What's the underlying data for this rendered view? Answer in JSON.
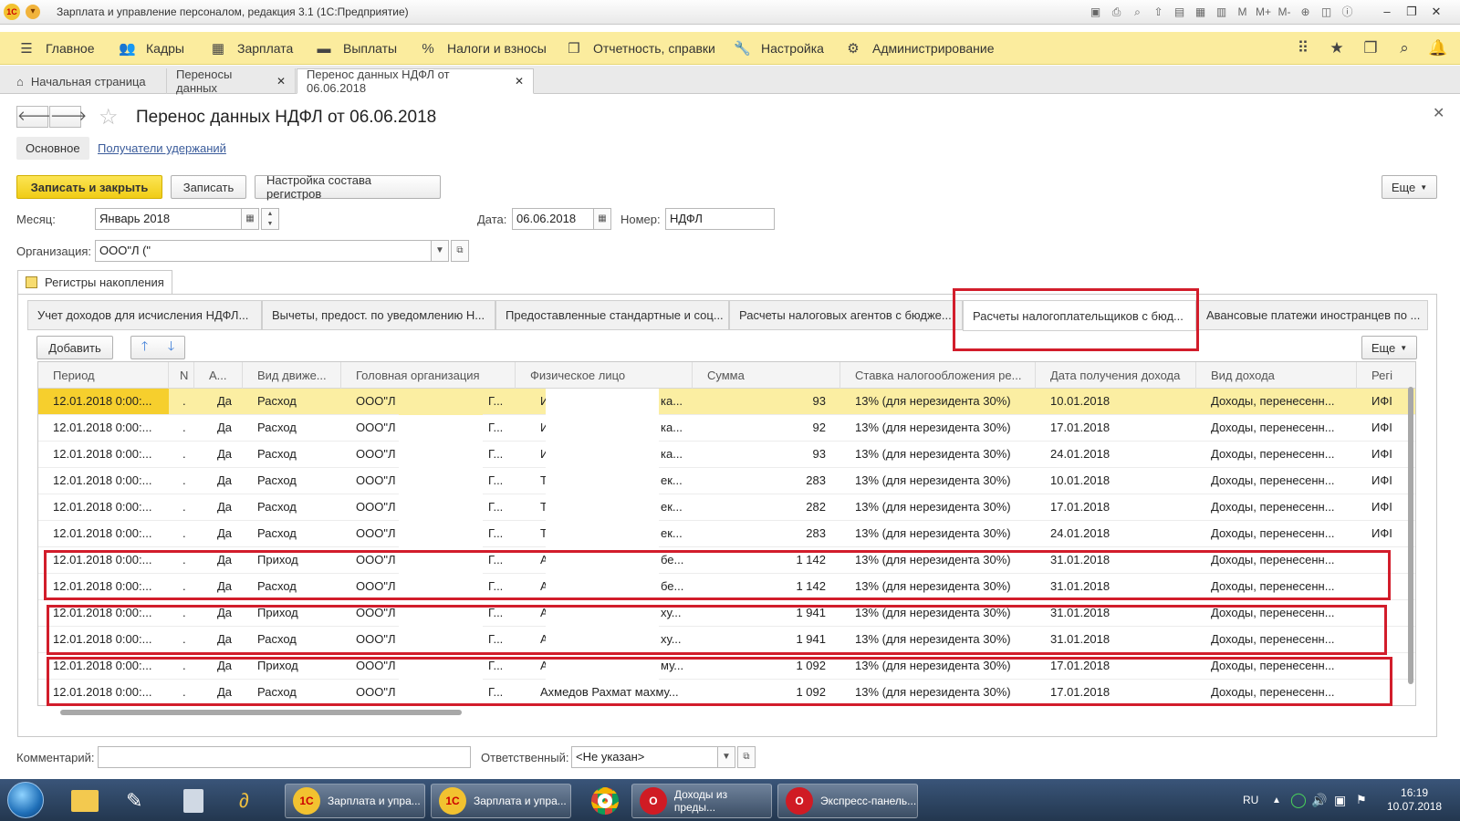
{
  "window": {
    "title": "Зарплата и управление персоналом, редакция 3.1  (1С:Предприятие)"
  },
  "main_menu": [
    "Главное",
    "Кадры",
    "Зарплата",
    "Выплаты",
    "Налоги и взносы",
    "Отчетность, справки",
    "Настройка",
    "Администрирование"
  ],
  "window_tabs": [
    "Начальная страница",
    "Переносы данных",
    "Перенос данных НДФЛ от 06.06.2018"
  ],
  "form": {
    "title": "Перенос данных НДФЛ от 06.06.2018",
    "subnav": [
      "Основное",
      "Получатели удержаний"
    ],
    "buttons": {
      "save_close": "Записать и закрыть",
      "save": "Записать",
      "registers": "Настройка состава регистров",
      "more": "Еще"
    },
    "month_label": "Месяц:",
    "month_value": "Январь 2018",
    "date_label": "Дата:",
    "date_value": "06.06.2018",
    "number_label": "Номер:",
    "number_value": "НДФЛ",
    "org_label": "Организация:",
    "org_value": "ООО\"Л                 (\"",
    "group_tab": "Регистры накопления",
    "register_tabs": [
      "Учет доходов для исчисления НДФЛ...",
      "Вычеты, предост. по уведомлению Н...",
      "Предоставленные стандартные и соц...",
      "Расчеты налоговых агентов с бюдже...",
      "Расчеты налогоплательщиков с бюд...",
      "Авансовые платежи иностранцев по ..."
    ],
    "grid_buttons": {
      "add": "Добавить",
      "more": "Еще"
    },
    "comment_label": "Комментарий:",
    "responsible_label": "Ответственный:",
    "responsible_value": "<Не указан>"
  },
  "grid": {
    "columns": [
      "Период",
      "N",
      "А...",
      "Вид движе...",
      "Головная организация",
      "Физическое лицо",
      "Сумма",
      "Ставка налогообложения ре...",
      "Дата получения дохода",
      "Вид дохода",
      "Регі"
    ],
    "rows": [
      [
        "12.01.2018 0:00:...",
        ".",
        "Да",
        "Расход",
        "ООО\"Л",
        "Г...",
        "И",
        "ка...",
        "93",
        "13% (для нерезидента 30%)",
        "10.01.2018",
        "Доходы, перенесенн...",
        "ИФІ"
      ],
      [
        "12.01.2018 0:00:...",
        ".",
        "Да",
        "Расход",
        "ООО\"Л",
        "Г...",
        "И",
        "ка...",
        "92",
        "13% (для нерезидента 30%)",
        "17.01.2018",
        "Доходы, перенесенн...",
        "ИФІ"
      ],
      [
        "12.01.2018 0:00:...",
        ".",
        "Да",
        "Расход",
        "ООО\"Л",
        "Г...",
        "И",
        "ка...",
        "93",
        "13% (для нерезидента 30%)",
        "24.01.2018",
        "Доходы, перенесенн...",
        "ИФІ"
      ],
      [
        "12.01.2018 0:00:...",
        ".",
        "Да",
        "Расход",
        "ООО\"Л",
        "Г...",
        "Т",
        "ек...",
        "283",
        "13% (для нерезидента 30%)",
        "10.01.2018",
        "Доходы, перенесенн...",
        "ИФІ"
      ],
      [
        "12.01.2018 0:00:...",
        ".",
        "Да",
        "Расход",
        "ООО\"Л",
        "Г...",
        "Т",
        "ек...",
        "282",
        "13% (для нерезидента 30%)",
        "17.01.2018",
        "Доходы, перенесенн...",
        "ИФІ"
      ],
      [
        "12.01.2018 0:00:...",
        ".",
        "Да",
        "Расход",
        "ООО\"Л",
        "Г...",
        "Т",
        "ек...",
        "283",
        "13% (для нерезидента 30%)",
        "24.01.2018",
        "Доходы, перенесенн...",
        "ИФІ"
      ],
      [
        "12.01.2018 0:00:...",
        ".",
        "Да",
        "Приход",
        "ООО\"Л",
        "Г...",
        "А",
        "бе...",
        "1 142",
        "13% (для нерезидента 30%)",
        "31.01.2018",
        "Доходы, перенесенн...",
        ""
      ],
      [
        "12.01.2018 0:00:...",
        ".",
        "Да",
        "Расход",
        "ООО\"Л",
        "Г...",
        "А",
        "бе...",
        "1 142",
        "13% (для нерезидента 30%)",
        "31.01.2018",
        "Доходы, перенесенн...",
        ""
      ],
      [
        "12.01.2018 0:00:...",
        ".",
        "Да",
        "Приход",
        "ООО\"Л",
        "Г...",
        "А",
        "ху...",
        "1 941",
        "13% (для нерезидента 30%)",
        "31.01.2018",
        "Доходы, перенесенн...",
        ""
      ],
      [
        "12.01.2018 0:00:...",
        ".",
        "Да",
        "Расход",
        "ООО\"Л",
        "Г...",
        "А",
        "ху...",
        "1 941",
        "13% (для нерезидента 30%)",
        "31.01.2018",
        "Доходы, перенесенн...",
        ""
      ],
      [
        "12.01.2018 0:00:...",
        ".",
        "Да",
        "Приход",
        "ООО\"Л",
        "Г...",
        "А",
        "му...",
        "1 092",
        "13% (для нерезидента 30%)",
        "17.01.2018",
        "Доходы, перенесенн...",
        ""
      ],
      [
        "12.01.2018 0:00:...",
        ".",
        "Да",
        "Расход",
        "ООО\"Л",
        "Г...",
        "Ахмедов Рахмат махму...",
        "",
        "1 092",
        "13% (для нерезидента 30%)",
        "17.01.2018",
        "Доходы, перенесенн...",
        ""
      ]
    ]
  },
  "taskbar": {
    "apps": [
      "Зарплата и упра...",
      "Зарплата и упра...",
      "Доходы из преды...",
      "Экспресс-панель..."
    ],
    "lang": "RU",
    "time": "16:19",
    "date": "10.07.2018"
  },
  "colors": {
    "menu_bg": "#fbec9e",
    "primary": "#f0cc16",
    "highlight": "#d21d2b",
    "selected_row": "#fbeea2"
  }
}
